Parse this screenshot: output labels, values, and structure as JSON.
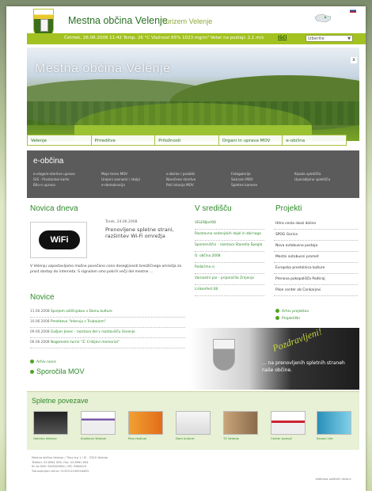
{
  "header": {
    "title": "Mestna občina Velenje",
    "subtitle": "Turizem Velenje"
  },
  "infobar": {
    "text": "Četrtek, 26.06.2008  11:42   Temp. 26 °C   Vlažnost 65%  1023 mg/m³   Veter na postaji: 2,1 m/s",
    "search_label": "Išči",
    "select_value": "Izberite"
  },
  "hero": {
    "title": "Mestna občina Velenje",
    "close": "x"
  },
  "nav": {
    "items": [
      "Velenje",
      "Prireditve",
      "Priložnosti",
      "Organi in uprava MOV",
      "e-občina"
    ]
  },
  "eobcina": {
    "title": "e-občina",
    "columns": [
      [
        "e-vloge/e-storitve uprave",
        "GIS - Prostorske karte",
        "Bilo-n upravo"
      ],
      [
        "Moje teme MOV",
        "Urejeni seznami / stolpi",
        "e-demokracija"
      ],
      [
        "e-zbirke / podatki",
        "Naročene storitve",
        "Poti iskanja MOV"
      ],
      [
        "Fotogalerija",
        "Seznam MOV",
        "Spletne kamere"
      ],
      [
        "Kazalo spletišča",
        "Uporabljene spletišča"
      ]
    ]
  },
  "news": {
    "section_title": "Novica dneva",
    "date": "Torek, 24.06.2008",
    "headline": "Prenovljene spletne strani, razširitev Wi-Fi omrežja",
    "body": "V Velenju vzpostavljamo možne povečano cono dosegljivosti brezžičnega omrežja za prost dostop do interneta. S signalom smo pokrili večji del mestne ...",
    "image_label": "WiFi"
  },
  "novice": {
    "title": "Novice",
    "items": [
      {
        "date": "11.06.2008",
        "text": "Sprejem odličnjakov v Domu kulture"
      },
      {
        "date": "10.06.2008",
        "text": "Predstava \"Intervju s Trubarjem\""
      },
      {
        "date": "09.06.2008",
        "text": "Gašper Jenec - razstava del v razstavišču Gorenje"
      },
      {
        "date": "06.06.2008",
        "text": "Nogometni turnir \"Z. Crikljevi memorial\""
      }
    ],
    "archive": "Arhiv novic",
    "sporocila": "Sporočila MOV"
  },
  "vsredistu": {
    "title": "V središču",
    "items": [
      "VELENJart08",
      "Razstavna vedenjskih dojel in zbirnega",
      "Spomeniščni - razstava Stanetia Špegla",
      "O. občina 2008",
      "Podarimo.si",
      "Varnostni par - priporočila Zrnjenja",
      "Lirikonfest 08"
    ]
  },
  "projekti": {
    "title": "Projekti",
    "items": [
      "Hitra cesta skozi dolino",
      "SPOG Gorica",
      "Nova avtobusna postaja",
      "Mestni avtobusni promet",
      "Evropska prestolnica kulture",
      "Prenova pokopališča Podkraj",
      "Pilon center ob Cankarjevi"
    ],
    "archive": "Arhiv projektov",
    "projects": "Projektiški"
  },
  "banner": {
    "greeting": "Pozdravljeni!",
    "text": "... na prenovljenih spletnih straneh naše občine."
  },
  "links": {
    "title": "Spletne povezave",
    "items": [
      "Galerija Velenje",
      "Knjižnica Velenje",
      "Plan festival",
      "Dom kulture",
      "TV Velenje",
      "Center pomoč",
      "Sezoni Life"
    ]
  },
  "footer": {
    "address": [
      "Mestna občina Velenje / Titov trg 1 / SI - 3320 Velenje",
      "Telefon: 03 8961 600, Fax: 03 8961 654",
      "ID za DDV: SI49363964 / MŠ: 5884420",
      "Transakcijski račun: 01333-0100016483"
    ],
    "credit": "Izdelava spletnih strani:"
  }
}
